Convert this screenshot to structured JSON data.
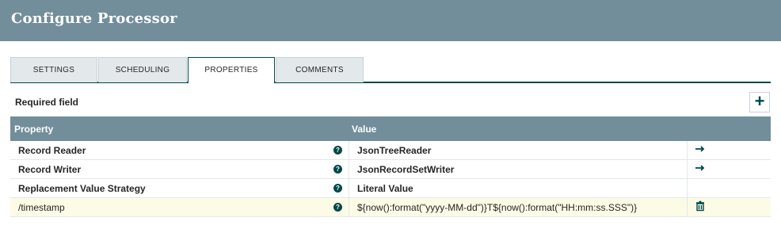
{
  "dialog": {
    "title": "Configure Processor"
  },
  "tabs": [
    {
      "label": "SETTINGS",
      "active": false
    },
    {
      "label": "SCHEDULING",
      "active": false
    },
    {
      "label": "PROPERTIES",
      "active": true
    },
    {
      "label": "COMMENTS",
      "active": false
    }
  ],
  "properties": {
    "required_label": "Required field",
    "add_icon": "plus-icon",
    "columns": {
      "property": "Property",
      "value": "Value"
    },
    "rows": [
      {
        "name": "Record Reader",
        "value": "JsonTreeReader",
        "required": true,
        "action": "arrow-right-icon"
      },
      {
        "name": "Record Writer",
        "value": "JsonRecordSetWriter",
        "required": true,
        "action": "arrow-right-icon"
      },
      {
        "name": "Replacement Value Strategy",
        "value": "Literal Value",
        "required": true,
        "action": ""
      },
      {
        "name": "/timestamp",
        "value": "${now():format(\"yyyy-MM-dd\")}T${now():format(\"HH:mm:ss.SSS\")}",
        "required": false,
        "action": "trash-icon"
      }
    ]
  },
  "colors": {
    "header": "#728e9b",
    "accent": "#004849",
    "highlight_row": "#fcfbe6"
  }
}
